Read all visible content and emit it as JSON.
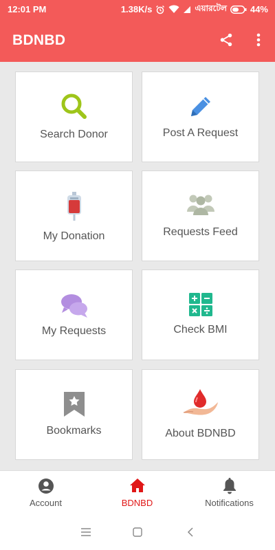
{
  "status_bar": {
    "time": "12:01 PM",
    "speed": "1.38K/s",
    "carrier": "এয়ারটেল",
    "battery": "44%"
  },
  "app_bar": {
    "title": "BDNBD",
    "share_icon": "share-icon",
    "more_icon": "more-vert-icon"
  },
  "tiles": [
    {
      "label": "Search Donor",
      "icon": "search-icon",
      "color": "#9ec51a"
    },
    {
      "label": "Post A Request",
      "icon": "pencil-icon",
      "color": "#4a90e2"
    },
    {
      "label": "My Donation",
      "icon": "blood-bag-icon",
      "color": "#d63a3a"
    },
    {
      "label": "Requests Feed",
      "icon": "group-icon",
      "color": "#c2c9b8"
    },
    {
      "label": "My Requests",
      "icon": "chat-bubbles-icon",
      "color": "#b38ee0"
    },
    {
      "label": "Check BMI",
      "icon": "calculator-icon",
      "color": "#20b88e"
    },
    {
      "label": "Bookmarks",
      "icon": "bookmark-icon",
      "color": "#8e8e8e"
    },
    {
      "label": "About BDNBD",
      "icon": "blood-drop-hand-icon",
      "color": "#e02b2b"
    }
  ],
  "bottom_nav": [
    {
      "label": "Account",
      "icon": "account-circle-icon",
      "active": false
    },
    {
      "label": "BDNBD",
      "icon": "home-icon",
      "active": true
    },
    {
      "label": "Notifications",
      "icon": "bell-icon",
      "active": false
    }
  ],
  "colors": {
    "primary": "#f35a59",
    "active_nav": "#e01717",
    "background": "#e9e9e9"
  }
}
